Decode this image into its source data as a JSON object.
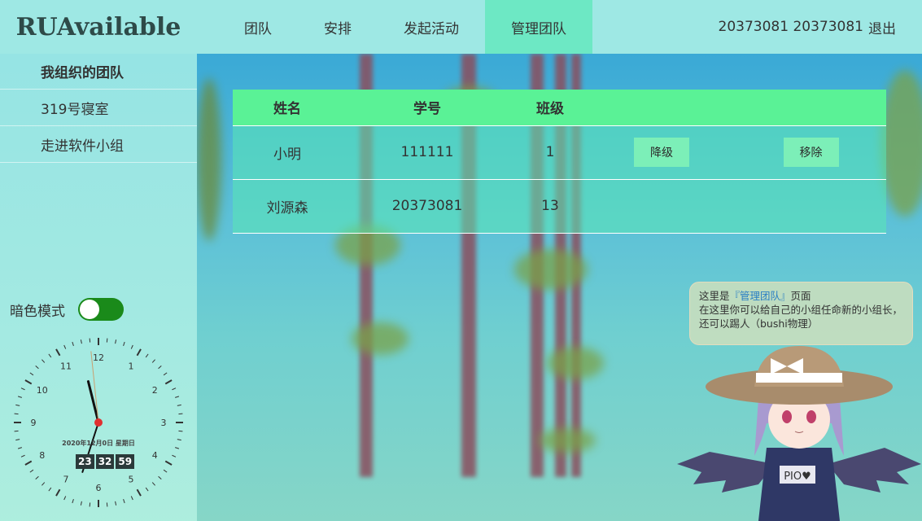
{
  "app": {
    "brand": "RUAvailable"
  },
  "nav": {
    "items": [
      {
        "label": "团队",
        "active": false
      },
      {
        "label": "安排",
        "active": false
      },
      {
        "label": "发起活动",
        "active": false
      },
      {
        "label": "管理团队",
        "active": true
      }
    ]
  },
  "user": {
    "name": "20373081 20373081",
    "logout_label": "退出"
  },
  "sidebar": {
    "items": [
      {
        "label": "我组织的团队"
      },
      {
        "label": "319号寝室"
      },
      {
        "label": "走进软件小组"
      }
    ],
    "dark_mode_label": "暗色模式",
    "dark_mode_on": true
  },
  "clock": {
    "date": "2020年12月0日 星期日",
    "hours": "23",
    "minutes": "32",
    "seconds": "59",
    "numbers": [
      "12",
      "1",
      "2",
      "3",
      "4",
      "5",
      "6",
      "7",
      "8",
      "9",
      "10",
      "11"
    ]
  },
  "table": {
    "headers": [
      "姓名",
      "学号",
      "班级"
    ],
    "rows": [
      {
        "name": "小明",
        "id": "111111",
        "class": "1",
        "demote_label": "降级",
        "remove_label": "移除"
      },
      {
        "name": "刘源森",
        "id": "20373081",
        "class": "13"
      }
    ]
  },
  "mascot": {
    "message_prefix": "这里是",
    "message_highlight": "『管理团队』",
    "message_suffix": "页面",
    "message_line2": "在这里你可以给自己的小组任命新的小组长，还可以踢人（bushi物理）",
    "badge": "PIO♥"
  },
  "colors": {
    "accent": "#5af296",
    "nav_active": "#6de8c4",
    "toggle_on": "#1a8a1a",
    "clock_center": "#e03030"
  }
}
